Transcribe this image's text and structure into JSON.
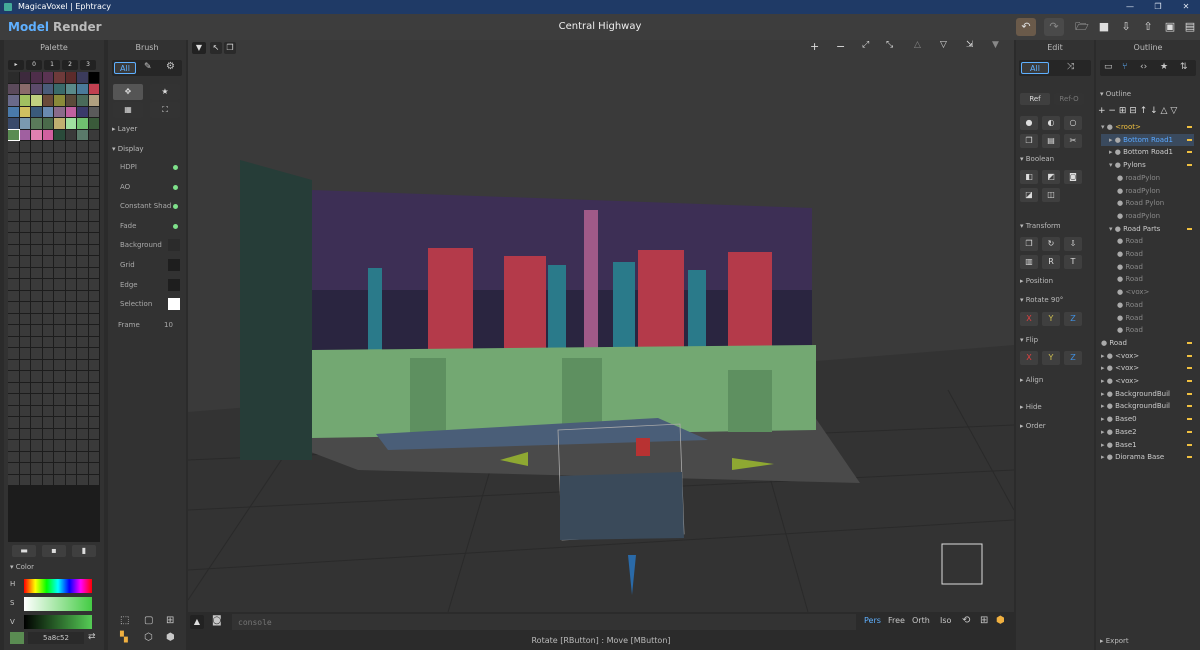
{
  "app_title": "MagicaVoxel | Ephtracy",
  "window_controls": [
    "—",
    "❐",
    "✕"
  ],
  "menu": {
    "model": "Model",
    "render": "Render"
  },
  "scene_title": "Central Highway",
  "palette": {
    "title": "Palette",
    "tabs": [
      "▸",
      "0",
      "1",
      "2",
      "3"
    ],
    "colors": [
      "#2b2b2b",
      "#3d2a3d",
      "#4e2e4a",
      "#5a3352",
      "#6e3a3a",
      "#5c2b2b",
      "#3b3b5c",
      "#000000",
      "#5b4a5b",
      "#8a6a6a",
      "#5c4a6a",
      "#4a5c7a",
      "#3a6a6a",
      "#5a8a8a",
      "#4a7a9a",
      "#c04050",
      "#6a6a8a",
      "#a0c060",
      "#c0d080",
      "#6a4a3a",
      "#8a8a3a",
      "#5a4a3a",
      "#4a6a5a",
      "#b0a080",
      "#4a7aaa",
      "#d0c060",
      "#3a5a7a",
      "#6a8ab0",
      "#8a6a8a",
      "#c060a0",
      "#3a3a6a",
      "#5a5a5a",
      "#3a4a6a",
      "#7a9ab0",
      "#5a7a5a",
      "#4a6a4a",
      "#c0b070",
      "#a0e0a0",
      "#70c070",
      "#3a5a3a",
      "#5a8c52",
      "#a060a0",
      "#e080b0",
      "#d060a0",
      "#2a4a3a",
      "#3a3a3a",
      "#5a7a6a",
      "#3a3a3a"
    ],
    "footer_icons": [
      "folder-icon",
      "save-icon",
      "file-icon"
    ]
  },
  "color": {
    "title": "Color",
    "h": "H",
    "s": "S",
    "v": "V",
    "hex": "5a8c52",
    "current": "#5a8c52"
  },
  "brush": {
    "title": "Brush",
    "mode": "All",
    "layer": "Layer",
    "display": "Display",
    "options": [
      {
        "label": "HDPI",
        "kind": "dot"
      },
      {
        "label": "AO",
        "kind": "dot"
      },
      {
        "label": "Constant Shad",
        "kind": "dot"
      },
      {
        "label": "Fade",
        "kind": "dot"
      },
      {
        "label": "Background",
        "kind": "swatch",
        "color": "#2b2b2b"
      },
      {
        "label": "Grid",
        "kind": "swatch",
        "color": "#1e1e1e"
      },
      {
        "label": "Edge",
        "kind": "swatch",
        "color": "#1e1e1e"
      },
      {
        "label": "Selection",
        "kind": "swatch",
        "color": "#ffffff"
      }
    ],
    "frame_label": "Frame",
    "frame_value": "10"
  },
  "viewport": {
    "console_placeholder": "console",
    "views": [
      "Pers",
      "Free",
      "Orth",
      "Iso"
    ],
    "active_view": "Pers",
    "status": "Rotate [RButton] : Move [MButton]"
  },
  "edit": {
    "title": "Edit",
    "mode_all": "All",
    "ref": "Ref",
    "ref_o": "Ref-O",
    "boolean": "Boolean",
    "transform": "Transform",
    "transform_r": "R",
    "transform_t": "T",
    "position": "Position",
    "rotate": "Rotate 90°",
    "axes": [
      "X",
      "Y",
      "Z"
    ],
    "flip": "Flip",
    "align": "Align",
    "hide": "Hide",
    "order": "Order"
  },
  "outline": {
    "title": "Outline",
    "section": "Outline",
    "export": "Export",
    "items": [
      {
        "label": "<root>",
        "indent": 0,
        "color": "#f0c040",
        "arrow": "▾"
      },
      {
        "label": "Bottom Road1",
        "indent": 1,
        "color": "#5aa8ff",
        "arrow": "▸"
      },
      {
        "label": "Bottom Road1",
        "indent": 1,
        "color": "#cccccc",
        "arrow": "▸"
      },
      {
        "label": "Pylons",
        "indent": 1,
        "color": "#cccccc",
        "arrow": "▾"
      },
      {
        "label": "roadPylon",
        "indent": 2,
        "color": "#888888",
        "arrow": ""
      },
      {
        "label": "roadPylon",
        "indent": 2,
        "color": "#888888",
        "arrow": ""
      },
      {
        "label": "Road Pylon",
        "indent": 2,
        "color": "#888888",
        "arrow": ""
      },
      {
        "label": "roadPylon",
        "indent": 2,
        "color": "#888888",
        "arrow": ""
      },
      {
        "label": "Road Parts",
        "indent": 1,
        "color": "#cccccc",
        "arrow": "▾"
      },
      {
        "label": "Road",
        "indent": 2,
        "color": "#888888",
        "arrow": ""
      },
      {
        "label": "Road",
        "indent": 2,
        "color": "#888888",
        "arrow": ""
      },
      {
        "label": "Road",
        "indent": 2,
        "color": "#888888",
        "arrow": ""
      },
      {
        "label": "Road",
        "indent": 2,
        "color": "#888888",
        "arrow": ""
      },
      {
        "label": "<vox>",
        "indent": 2,
        "color": "#888888",
        "arrow": ""
      },
      {
        "label": "Road",
        "indent": 2,
        "color": "#888888",
        "arrow": ""
      },
      {
        "label": "Road",
        "indent": 2,
        "color": "#888888",
        "arrow": ""
      },
      {
        "label": "Road",
        "indent": 2,
        "color": "#888888",
        "arrow": ""
      },
      {
        "label": "Road",
        "indent": 0,
        "color": "#cccccc",
        "arrow": ""
      },
      {
        "label": "<vox>",
        "indent": 0,
        "color": "#cccccc",
        "arrow": "▸"
      },
      {
        "label": "<vox>",
        "indent": 0,
        "color": "#cccccc",
        "arrow": "▸"
      },
      {
        "label": "<vox>",
        "indent": 0,
        "color": "#cccccc",
        "arrow": "▸"
      },
      {
        "label": "BackgroundBuil",
        "indent": 0,
        "color": "#cccccc",
        "arrow": "▸"
      },
      {
        "label": "BackgroundBuil",
        "indent": 0,
        "color": "#cccccc",
        "arrow": "▸"
      },
      {
        "label": "Base0",
        "indent": 0,
        "color": "#cccccc",
        "arrow": "▸"
      },
      {
        "label": "Base2",
        "indent": 0,
        "color": "#cccccc",
        "arrow": "▸"
      },
      {
        "label": "Base1",
        "indent": 0,
        "color": "#cccccc",
        "arrow": "▸"
      },
      {
        "label": "Diorama Base",
        "indent": 0,
        "color": "#cccccc",
        "arrow": "▸"
      }
    ]
  }
}
